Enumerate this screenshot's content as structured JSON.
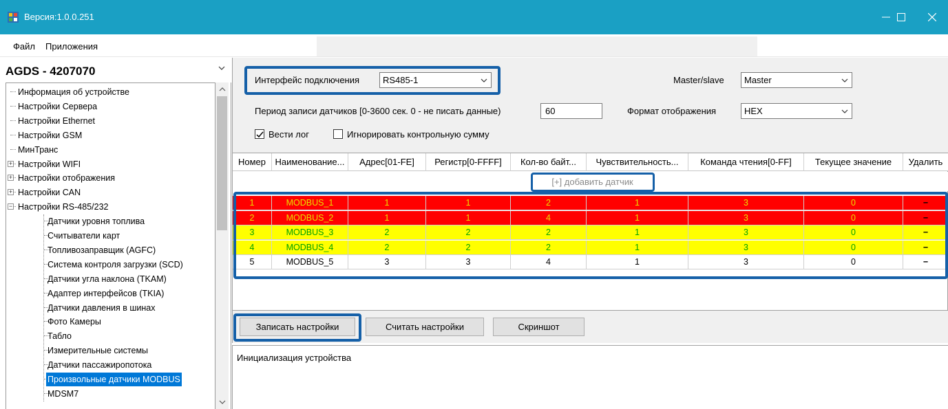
{
  "window": {
    "title": "Версия:1.0.0.251"
  },
  "menu": {
    "items": [
      "Файл",
      "Приложения"
    ]
  },
  "device_combo": {
    "value": "AGDS - 4207070"
  },
  "tree": {
    "items": [
      {
        "label": "Информация об устройстве",
        "level": 0,
        "expander": "",
        "selected": false
      },
      {
        "label": "Настройки Сервера",
        "level": 0,
        "expander": "",
        "selected": false
      },
      {
        "label": "Настройки Ethernet",
        "level": 0,
        "expander": "",
        "selected": false
      },
      {
        "label": "Настройки GSM",
        "level": 0,
        "expander": "",
        "selected": false
      },
      {
        "label": "МинТранс",
        "level": 0,
        "expander": "",
        "selected": false
      },
      {
        "label": "Настройки WIFI",
        "level": 0,
        "expander": "+",
        "selected": false
      },
      {
        "label": "Настройки отображения",
        "level": 0,
        "expander": "+",
        "selected": false
      },
      {
        "label": "Настройки CAN",
        "level": 0,
        "expander": "+",
        "selected": false
      },
      {
        "label": "Настройки RS-485/232",
        "level": 0,
        "expander": "−",
        "selected": false
      },
      {
        "label": "Датчики уровня топлива",
        "level": 1,
        "expander": "",
        "selected": false
      },
      {
        "label": "Считыватели карт",
        "level": 1,
        "expander": "",
        "selected": false
      },
      {
        "label": "Топливозаправщик (AGFC)",
        "level": 1,
        "expander": "",
        "selected": false
      },
      {
        "label": "Система контроля загрузки (SCD)",
        "level": 1,
        "expander": "",
        "selected": false
      },
      {
        "label": "Датчики угла наклона (TKAM)",
        "level": 1,
        "expander": "",
        "selected": false
      },
      {
        "label": "Адаптер интерфейсов (TKIA)",
        "level": 1,
        "expander": "",
        "selected": false
      },
      {
        "label": "Датчики давления в шинах",
        "level": 1,
        "expander": "",
        "selected": false
      },
      {
        "label": "Фото Камеры",
        "level": 1,
        "expander": "",
        "selected": false
      },
      {
        "label": "Табло",
        "level": 1,
        "expander": "",
        "selected": false
      },
      {
        "label": "Измерительные системы",
        "level": 1,
        "expander": "",
        "selected": false
      },
      {
        "label": "Датчики пассажиропотока",
        "level": 1,
        "expander": "",
        "selected": false
      },
      {
        "label": "Произвольные датчики MODBUS",
        "level": 1,
        "expander": "",
        "selected": true
      },
      {
        "label": "MDSM7",
        "level": 1,
        "expander": "",
        "selected": false
      }
    ]
  },
  "settings": {
    "interface_label": "Интерфейс подключения",
    "interface_value": "RS485-1",
    "master_label": "Master/slave",
    "master_value": "Master",
    "period_label": "Период записи датчиков [0-3600 сек. 0 - не писать данные)",
    "period_value": "60",
    "format_label": "Формат отображения",
    "format_value": "HEX",
    "log_checkbox_label": "Вести лог",
    "log_checked": true,
    "ignore_crc_label": "Игнорировать контрольную сумму",
    "ignore_crc_checked": false
  },
  "grid": {
    "columns": [
      "Номер",
      "Наименование...",
      "Адрес[01-FE]",
      "Регистр[0-FFFF]",
      "Кол-во байт...",
      "Чувствительность...",
      "Команда чтения[0-FF]",
      "Текущее значение",
      "Удалить"
    ],
    "add_label": "[+] добавить датчик",
    "delete_symbol": "−",
    "rows": [
      {
        "status": "red",
        "cells": [
          "1",
          "MODBUS_1",
          "1",
          "1",
          "2",
          "1",
          "3",
          "0"
        ]
      },
      {
        "status": "red",
        "cells": [
          "2",
          "MODBUS_2",
          "1",
          "1",
          "4",
          "1",
          "3",
          "0"
        ]
      },
      {
        "status": "yellow",
        "cells": [
          "3",
          "MODBUS_3",
          "2",
          "2",
          "2",
          "1",
          "3",
          "0"
        ]
      },
      {
        "status": "yellow",
        "cells": [
          "4",
          "MODBUS_4",
          "2",
          "2",
          "2",
          "1",
          "3",
          "0"
        ]
      },
      {
        "status": "white",
        "cells": [
          "5",
          "MODBUS_5",
          "3",
          "3",
          "4",
          "1",
          "3",
          "0"
        ]
      }
    ]
  },
  "buttons": {
    "write": "Записать настройки",
    "read": "Считать настройки",
    "screenshot": "Скриншот"
  },
  "log": {
    "text": "Инициализация устройства"
  },
  "colors": {
    "titlebar": "#1aa0c4",
    "highlight": "#1560a8",
    "row_red": "#ff0000",
    "row_yellow": "#ffff00",
    "selection": "#0078d7"
  }
}
